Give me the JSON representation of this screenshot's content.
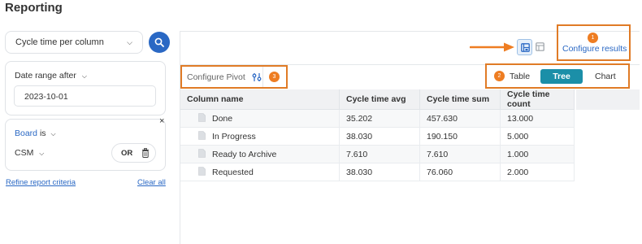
{
  "page": {
    "title": "Reporting"
  },
  "criteria": {
    "report_type": "Cycle time per column",
    "date_filter": {
      "label": "Date range after",
      "value": "2023-10-01"
    },
    "board_filter": {
      "field": "Board",
      "operator": "is",
      "value": "CSM",
      "logic": "OR"
    },
    "refine_link": "Refine report criteria",
    "clear_link": "Clear all"
  },
  "results": {
    "configure_results_label": "Configure results",
    "configure_pivot_label": "Configure Pivot",
    "view_modes": [
      "Table",
      "Tree",
      "Chart"
    ],
    "active_view_mode": "Tree",
    "callouts": [
      "1",
      "2",
      "3"
    ],
    "columns": [
      "Column name",
      "Cycle time avg",
      "Cycle time sum",
      "Cycle time count"
    ],
    "rows": [
      [
        "Done",
        "35.202",
        "457.630",
        "13.000"
      ],
      [
        "In Progress",
        "38.030",
        "190.150",
        "5.000"
      ],
      [
        "Ready to Archive",
        "7.610",
        "7.610",
        "1.000"
      ],
      [
        "Requested",
        "38.030",
        "76.060",
        "2.000"
      ]
    ]
  },
  "colors": {
    "accent": "#2a68c4",
    "highlight": "#e07b26",
    "tree_active": "#1b8fa8"
  }
}
